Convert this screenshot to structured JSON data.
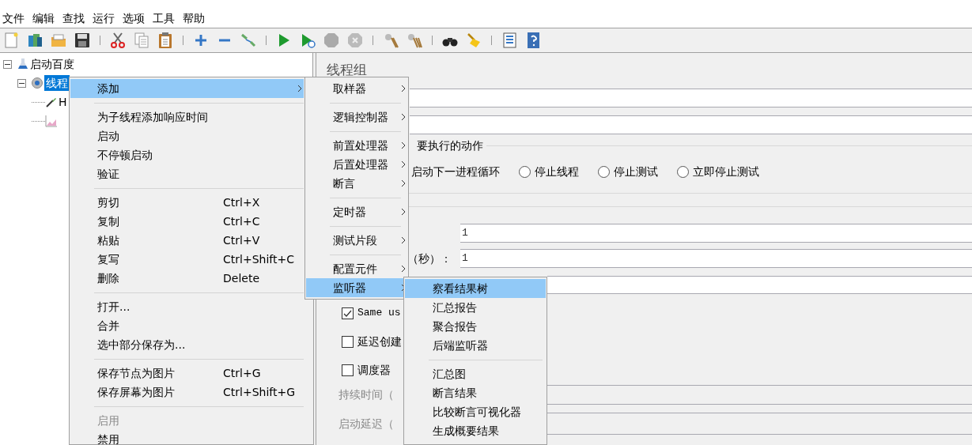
{
  "menubar": [
    "文件",
    "编辑",
    "查找",
    "运行",
    "选项",
    "工具",
    "帮助"
  ],
  "tree": [
    {
      "label": "启动百度",
      "kind": "testplan",
      "expanded": true,
      "selected": false,
      "children": [
        {
          "label": "线程",
          "kind": "threadgroup",
          "expanded": true,
          "selected": true,
          "children": [
            {
              "label": "H",
              "kind": "sampler",
              "selected": false
            },
            {
              "kind": "listener"
            }
          ]
        }
      ]
    }
  ],
  "panel": {
    "title": "线程组",
    "group_legend": "要执行的动作",
    "radios": [
      {
        "kind": "text",
        "label": "启动下一进程循环"
      },
      {
        "kind": "radio",
        "label": "停止线程",
        "selected": false
      },
      {
        "kind": "radio",
        "label": "停止测试",
        "selected": false
      },
      {
        "kind": "radio",
        "label": "立即停止测试",
        "selected": false
      }
    ],
    "threads_value": "1",
    "rampup_label": "（秒）：",
    "rampup_value": "1",
    "checkboxes": [
      {
        "label": "Same us",
        "checked": true,
        "mono": true
      },
      {
        "label": "延迟创建",
        "checked": false,
        "mono": false
      },
      {
        "label": "调度器",
        "checked": false,
        "mono": false
      }
    ],
    "disabled_fields": [
      {
        "label": "持续时间（"
      },
      {
        "label": "启动延迟（"
      }
    ]
  },
  "context_menu": [
    {
      "kind": "item",
      "label": "添加",
      "submenu": true,
      "selected": true,
      "disabled": false
    },
    {
      "kind": "separator"
    },
    {
      "kind": "item",
      "label": "为子线程添加响应时间",
      "submenu": false,
      "selected": false,
      "disabled": false
    },
    {
      "kind": "item",
      "label": "启动",
      "submenu": false,
      "selected": false,
      "disabled": false
    },
    {
      "kind": "item",
      "label": "不停顿启动",
      "submenu": false,
      "selected": false,
      "disabled": false
    },
    {
      "kind": "item",
      "label": "验证",
      "submenu": false,
      "selected": false,
      "disabled": false
    },
    {
      "kind": "separator"
    },
    {
      "kind": "item",
      "label": "剪切",
      "shortcut": "Ctrl+X",
      "submenu": false,
      "selected": false,
      "disabled": false
    },
    {
      "kind": "item",
      "label": "复制",
      "shortcut": "Ctrl+C",
      "submenu": false,
      "selected": false,
      "disabled": false
    },
    {
      "kind": "item",
      "label": "粘贴",
      "shortcut": "Ctrl+V",
      "submenu": false,
      "selected": false,
      "disabled": false
    },
    {
      "kind": "item",
      "label": "复写",
      "shortcut": "Ctrl+Shift+C",
      "submenu": false,
      "selected": false,
      "disabled": false
    },
    {
      "kind": "item",
      "label": "删除",
      "shortcut": "Delete",
      "submenu": false,
      "selected": false,
      "disabled": false
    },
    {
      "kind": "separator"
    },
    {
      "kind": "item",
      "label": "打开...",
      "submenu": false,
      "selected": false,
      "disabled": false
    },
    {
      "kind": "item",
      "label": "合并",
      "submenu": false,
      "selected": false,
      "disabled": false
    },
    {
      "kind": "item",
      "label": "选中部分保存为...",
      "submenu": false,
      "selected": false,
      "disabled": false
    },
    {
      "kind": "separator"
    },
    {
      "kind": "item",
      "label": "保存节点为图片",
      "shortcut": "Ctrl+G",
      "submenu": false,
      "selected": false,
      "disabled": false
    },
    {
      "kind": "item",
      "label": "保存屏幕为图片",
      "shortcut": "Ctrl+Shift+G",
      "submenu": false,
      "selected": false,
      "disabled": false
    },
    {
      "kind": "separator"
    },
    {
      "kind": "item",
      "label": "启用",
      "submenu": false,
      "selected": false,
      "disabled": true
    },
    {
      "kind": "item",
      "label": "禁用",
      "submenu": false,
      "selected": false,
      "disabled": false
    }
  ],
  "add_submenu": [
    {
      "kind": "item",
      "label": "取样器",
      "submenu": true,
      "selected": false
    },
    {
      "kind": "separator"
    },
    {
      "kind": "item",
      "label": "逻辑控制器",
      "submenu": true,
      "selected": false
    },
    {
      "kind": "separator"
    },
    {
      "kind": "item",
      "label": "前置处理器",
      "submenu": true,
      "selected": false
    },
    {
      "kind": "item",
      "label": "后置处理器",
      "submenu": true,
      "selected": false
    },
    {
      "kind": "item",
      "label": "断言",
      "submenu": true,
      "selected": false
    },
    {
      "kind": "separator"
    },
    {
      "kind": "item",
      "label": "定时器",
      "submenu": true,
      "selected": false
    },
    {
      "kind": "separator"
    },
    {
      "kind": "item",
      "label": "测试片段",
      "submenu": true,
      "selected": false
    },
    {
      "kind": "separator"
    },
    {
      "kind": "item",
      "label": "配置元件",
      "submenu": true,
      "selected": false
    },
    {
      "kind": "item",
      "label": "监听器",
      "submenu": true,
      "selected": true
    }
  ],
  "listener_submenu": [
    {
      "kind": "item",
      "label": "察看结果树",
      "selected": true
    },
    {
      "kind": "item",
      "label": "汇总报告",
      "selected": false
    },
    {
      "kind": "item",
      "label": "聚合报告",
      "selected": false
    },
    {
      "kind": "item",
      "label": "后端监听器",
      "selected": false
    },
    {
      "kind": "separator"
    },
    {
      "kind": "item",
      "label": "汇总图",
      "selected": false
    },
    {
      "kind": "item",
      "label": "断言结果",
      "selected": false
    },
    {
      "kind": "item",
      "label": "比较断言可视化器",
      "selected": false
    },
    {
      "kind": "item",
      "label": "生成概要结果",
      "selected": false
    }
  ]
}
